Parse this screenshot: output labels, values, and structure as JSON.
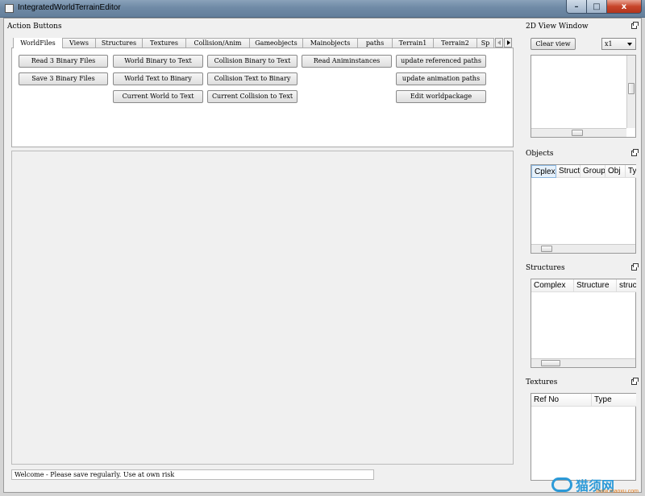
{
  "window": {
    "title": "IntegratedWorldTerrainEditor",
    "minimize_glyph": "–",
    "maximize_glyph": "□",
    "close_glyph": "x"
  },
  "action_dock": {
    "title": "Action Buttons"
  },
  "tabs": [
    "WorldFiles",
    "Views",
    "Structures",
    "Textures",
    "Collision/Anim",
    "Gameobjects",
    "Mainobjects",
    "paths",
    "Terrain1",
    "Terrain2",
    "Sp"
  ],
  "buttons": {
    "read_binary": "Read 3 Binary Files",
    "save_binary": "Save 3 Binary Files",
    "world_bin_to_text": "World Binary to Text",
    "world_text_to_bin": "World Text to Binary",
    "current_world_to_text": "Current World to Text",
    "collision_bin_to_text": "Collision Binary to Text",
    "collision_text_to_bin": "Collision Text to Binary",
    "current_collision_to_text": "Current Collision to Text",
    "read_animinstances": "Read Animinstances",
    "update_ref_paths": "update referenced paths",
    "update_anim_paths": "update animation paths",
    "edit_worldpackage": "Edit worldpackage"
  },
  "status": {
    "message": "Welcome - Please save regularly. Use at own  risk"
  },
  "view2d": {
    "title": "2D View Window",
    "clear_label": "Clear view",
    "zoom_value": "x1"
  },
  "objects": {
    "title": "Objects",
    "columns": [
      "Cplex",
      "Struct",
      "Group",
      "Obj",
      "Ty"
    ]
  },
  "structures": {
    "title": "Structures",
    "columns": [
      "Complex",
      "Structure",
      "struc"
    ]
  },
  "textures": {
    "title": "Textures",
    "columns": [
      "Ref No",
      "Type"
    ]
  },
  "watermark": {
    "text": "猫须网",
    "sub": "www.maoxu.com"
  }
}
